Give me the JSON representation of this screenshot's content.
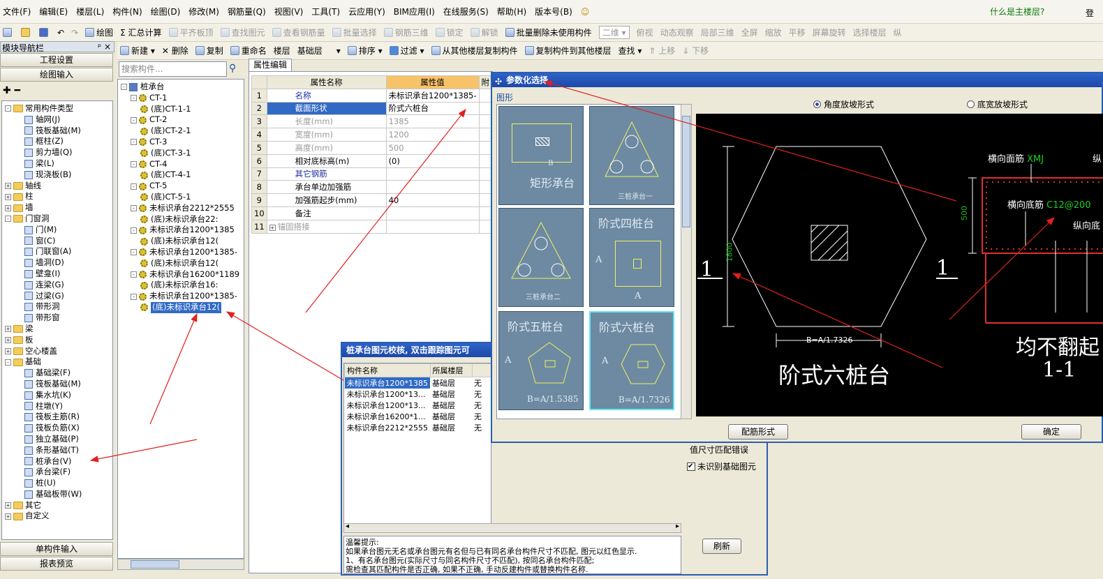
{
  "menu": {
    "items": [
      "文件(F)",
      "编辑(E)",
      "楼层(L)",
      "构件(N)",
      "绘图(D)",
      "修改(M)",
      "钢筋量(Q)",
      "视图(V)",
      "工具(T)",
      "云应用(Y)",
      "BIM应用(I)",
      "在线服务(S)",
      "帮助(H)",
      "版本号(B)"
    ],
    "hint": "什么是主楼层?",
    "right": "登"
  },
  "toolbar1": {
    "draw": "绘图",
    "sum": "汇总计算",
    "flat": "平齐板顶",
    "find": "查找图元",
    "view_rebar": "查看钢筋量",
    "batch": "批量选择",
    "rebar3d": "钢筋三维",
    "lock": "锁定",
    "unlock": "解锁",
    "batch_delete": "批量删除未使用构件",
    "view2d": "二维",
    "top": "俯视",
    "dynamic": "动态观察",
    "local3d": "局部三维",
    "full": "全屏",
    "zoom": "缩放",
    "pan": "平移",
    "rotate": "屏幕旋转",
    "select_floor": "选择楼层",
    "last": "纵"
  },
  "toolbar2": {
    "new": "新建",
    "delete": "删除",
    "copy": "复制",
    "rename": "重命名",
    "floor_label": "楼层",
    "floor_value": "基础层",
    "sort": "排序",
    "filter": "过滤",
    "copy_from": "从其他楼层复制构件",
    "copy_to": "复制构件到其他楼层",
    "search": "查找",
    "up": "上移",
    "down": "下移"
  },
  "nav": {
    "title": "模块导航栏",
    "pin": "ᵖ ×",
    "project": "工程设置",
    "draw_input": "绘图输入",
    "single": "单构件输入",
    "report": "报表预览",
    "tree": [
      {
        "t": "常用构件类型",
        "l": 0,
        "k": "f",
        "o": "-"
      },
      {
        "t": "轴网(J)",
        "l": 2,
        "k": "i"
      },
      {
        "t": "筏板基础(M)",
        "l": 2,
        "k": "i"
      },
      {
        "t": "框柱(Z)",
        "l": 2,
        "k": "i"
      },
      {
        "t": "剪力墙(Q)",
        "l": 2,
        "k": "i"
      },
      {
        "t": "梁(L)",
        "l": 2,
        "k": "i"
      },
      {
        "t": "现浇板(B)",
        "l": 2,
        "k": "i"
      },
      {
        "t": "轴线",
        "l": 0,
        "k": "f",
        "o": "+"
      },
      {
        "t": "柱",
        "l": 0,
        "k": "f",
        "o": "+"
      },
      {
        "t": "墙",
        "l": 0,
        "k": "f",
        "o": "+"
      },
      {
        "t": "门窗洞",
        "l": 0,
        "k": "f",
        "o": "-"
      },
      {
        "t": "门(M)",
        "l": 2,
        "k": "i"
      },
      {
        "t": "窗(C)",
        "l": 2,
        "k": "i"
      },
      {
        "t": "门联窗(A)",
        "l": 2,
        "k": "i"
      },
      {
        "t": "墙洞(D)",
        "l": 2,
        "k": "i"
      },
      {
        "t": "壁龛(I)",
        "l": 2,
        "k": "i"
      },
      {
        "t": "连梁(G)",
        "l": 2,
        "k": "i"
      },
      {
        "t": "过梁(G)",
        "l": 2,
        "k": "i"
      },
      {
        "t": "带形洞",
        "l": 2,
        "k": "i"
      },
      {
        "t": "带形窗",
        "l": 2,
        "k": "i"
      },
      {
        "t": "梁",
        "l": 0,
        "k": "f",
        "o": "+"
      },
      {
        "t": "板",
        "l": 0,
        "k": "f",
        "o": "+"
      },
      {
        "t": "空心楼盖",
        "l": 0,
        "k": "f",
        "o": "+"
      },
      {
        "t": "基础",
        "l": 0,
        "k": "f",
        "o": "-"
      },
      {
        "t": "基础梁(F)",
        "l": 2,
        "k": "i"
      },
      {
        "t": "筏板基础(M)",
        "l": 2,
        "k": "i"
      },
      {
        "t": "集水坑(K)",
        "l": 2,
        "k": "i"
      },
      {
        "t": "柱墩(Y)",
        "l": 2,
        "k": "i"
      },
      {
        "t": "筏板主筋(R)",
        "l": 2,
        "k": "i"
      },
      {
        "t": "筏板负筋(X)",
        "l": 2,
        "k": "i"
      },
      {
        "t": "独立基础(P)",
        "l": 2,
        "k": "i"
      },
      {
        "t": "条形基础(T)",
        "l": 2,
        "k": "i"
      },
      {
        "t": "桩承台(V)",
        "l": 2,
        "k": "i"
      },
      {
        "t": "承台梁(F)",
        "l": 2,
        "k": "i"
      },
      {
        "t": "桩(U)",
        "l": 2,
        "k": "i"
      },
      {
        "t": "基础板带(W)",
        "l": 2,
        "k": "i"
      },
      {
        "t": "其它",
        "l": 0,
        "k": "f",
        "o": "+"
      },
      {
        "t": "自定义",
        "l": 0,
        "k": "f",
        "o": "+"
      }
    ]
  },
  "comp": {
    "search_placeholder": "搜索构件...",
    "tree": [
      {
        "t": "桩承台",
        "l": 0,
        "k": "r",
        "o": "-"
      },
      {
        "t": "CT-1",
        "l": 1,
        "k": "g",
        "o": "-"
      },
      {
        "t": "(底)CT-1-1",
        "l": 2,
        "k": "g"
      },
      {
        "t": "CT-2",
        "l": 1,
        "k": "g",
        "o": "-"
      },
      {
        "t": "(底)CT-2-1",
        "l": 2,
        "k": "g"
      },
      {
        "t": "CT-3",
        "l": 1,
        "k": "g",
        "o": "-"
      },
      {
        "t": "(底)CT-3-1",
        "l": 2,
        "k": "g"
      },
      {
        "t": "CT-4",
        "l": 1,
        "k": "g",
        "o": "-"
      },
      {
        "t": "(底)CT-4-1",
        "l": 2,
        "k": "g"
      },
      {
        "t": "CT-5",
        "l": 1,
        "k": "g",
        "o": "-"
      },
      {
        "t": "(底)CT-5-1",
        "l": 2,
        "k": "g"
      },
      {
        "t": "未标识承台2212*2555",
        "l": 1,
        "k": "g",
        "o": "-"
      },
      {
        "t": "(底)未标识承台22:",
        "l": 2,
        "k": "g"
      },
      {
        "t": "未标识承台1200*1385",
        "l": 1,
        "k": "g",
        "o": "-"
      },
      {
        "t": "(底)未标识承台12(",
        "l": 2,
        "k": "g"
      },
      {
        "t": "未标识承台1200*1385-",
        "l": 1,
        "k": "g",
        "o": "-"
      },
      {
        "t": "(底)未标识承台12(",
        "l": 2,
        "k": "g"
      },
      {
        "t": "未标识承台16200*1189",
        "l": 1,
        "k": "g",
        "o": "-"
      },
      {
        "t": "(底)未标识承台16:",
        "l": 2,
        "k": "g"
      },
      {
        "t": "未标识承台1200*1385-",
        "l": 1,
        "k": "g",
        "o": "-"
      },
      {
        "t": "(底)未标识承台12(",
        "l": 2,
        "k": "g",
        "sel": true
      }
    ]
  },
  "props": {
    "tab": "属性编辑",
    "col_name": "属性名称",
    "col_value": "属性值",
    "col_extra": "附",
    "rows": [
      {
        "n": "1",
        "name": "名称",
        "value": "未标识承台1200*1385-",
        "c": "blue"
      },
      {
        "n": "2",
        "name": "截面形状",
        "value": "阶式六桩台",
        "c": "sel"
      },
      {
        "n": "3",
        "name": "长度(mm)",
        "value": "1385",
        "c": "grey"
      },
      {
        "n": "4",
        "name": "宽度(mm)",
        "value": "1200",
        "c": "grey"
      },
      {
        "n": "5",
        "name": "高度(mm)",
        "value": "500",
        "c": "grey"
      },
      {
        "n": "6",
        "name": "相对底标高(m)",
        "value": "(0)",
        "c": ""
      },
      {
        "n": "7",
        "name": "其它钢筋",
        "value": "",
        "c": "blue"
      },
      {
        "n": "8",
        "name": "承台单边加强筋",
        "value": "",
        "c": ""
      },
      {
        "n": "9",
        "name": "加强筋起步(mm)",
        "value": "40",
        "c": ""
      },
      {
        "n": "10",
        "name": "备注",
        "value": "",
        "c": ""
      },
      {
        "n": "11",
        "name": "锚固搭接",
        "value": "",
        "c": "grey",
        "plus": true
      }
    ]
  },
  "check": {
    "title": "桩承台图元校核, 双击跟踪图元可",
    "cols": [
      "构件名称",
      "所属楼层",
      "问"
    ],
    "rows": [
      [
        "未标识承台1200*1385",
        "基础层",
        "无"
      ],
      [
        "未标识承台1200*13...",
        "基础层",
        "无"
      ],
      [
        "未标识承台1200*13...",
        "基础层",
        "无"
      ],
      [
        "未标识承台16200*1...",
        "基础层",
        "无"
      ],
      [
        "未标识承台2212*2555",
        "基础层",
        "无"
      ]
    ],
    "tip_title": "温馨提示:",
    "tips": [
      "如果承台图元无名或承台图元有名但与已有同名承台构件尺寸不匹配, 图元以红色显示.",
      "1、有名承台图元(实际尺寸与同名构件尺寸不匹配), 按同名承台构件匹配;",
      "需检查其匹配构件是否正确, 如果不正确, 手动反建构件或替换构件名称."
    ],
    "side1": "值尺寸匹配错误",
    "side2": "未识别基础图元",
    "refresh": "刷新"
  },
  "param": {
    "title": "参数化选择",
    "group": "图形",
    "radio1": "角度放坡形式",
    "radio2": "底宽放坡形式",
    "thumbs": [
      "矩形承台",
      "三桩承台一",
      "三桩承台二",
      "阶式四桩台",
      "阶式五桩台",
      "阶式六桩台"
    ],
    "thumb_dims": {
      "b": "B",
      "a": "A",
      "b5": "B=A/1.5385",
      "b6": "B=A/1.7326"
    },
    "cad": {
      "dim_h": "1800",
      "dim_b": "B=A/1.7326",
      "sec": "1",
      "name": "阶式六桩台",
      "top_bar": "横向面筋",
      "top_bar_code": "XMJ",
      "bot_bar": "横向底筋",
      "bot_bar_code": "C12@200",
      "long_bar": "纵向底",
      "h500": "500",
      "no_turn": "均不翻起",
      "sec_label": "1-1",
      "cut_top": "纵"
    },
    "btn_rebar": "配筋形式",
    "btn_ok": "确定"
  },
  "colors": {
    "arrow": "#e02020",
    "dialog_title": "#2d63c8",
    "cad_bg": "#000000",
    "thumb_bg": "#6d8aa2"
  }
}
